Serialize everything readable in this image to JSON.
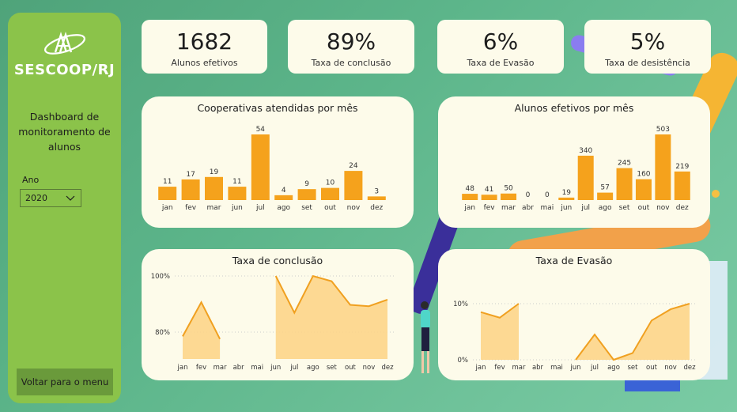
{
  "sidebar": {
    "logo_text": "SESCOOP/RJ",
    "title": "Dashboard de monitoramento de alunos",
    "filter_label": "Ano",
    "filter_value": "2020",
    "back_button": "Voltar para o menu"
  },
  "kpis": [
    {
      "value": "1682",
      "label": "Alunos efetivos"
    },
    {
      "value": "89%",
      "label": "Taxa de conclusão"
    },
    {
      "value": "6%",
      "label": "Taxa de Evasão"
    },
    {
      "value": "5%",
      "label": "Taxa de desistência"
    }
  ],
  "colors": {
    "bar": "#f5a21c",
    "area_fill": "#fdd58a",
    "area_line": "#f0a020",
    "sidebar": "#8bc34a",
    "card": "#fdfbea"
  },
  "chart_data": [
    {
      "type": "bar",
      "title": "Cooperativas atendidas por mês",
      "categories": [
        "jan",
        "fev",
        "mar",
        "jun",
        "jul",
        "ago",
        "set",
        "out",
        "nov",
        "dez"
      ],
      "values": [
        11,
        17,
        19,
        11,
        54,
        4,
        9,
        10,
        24,
        3
      ]
    },
    {
      "type": "bar",
      "title": "Alunos efetivos por mês",
      "categories": [
        "jan",
        "fev",
        "mar",
        "abr",
        "mai",
        "jun",
        "jul",
        "ago",
        "set",
        "out",
        "nov",
        "dez"
      ],
      "values": [
        48,
        41,
        50,
        0,
        0,
        19,
        340,
        57,
        245,
        160,
        503,
        219
      ]
    },
    {
      "type": "area",
      "title": "Taxa de conclusão",
      "categories": [
        "jan",
        "fev",
        "mar",
        "abr",
        "mai",
        "jun",
        "jul",
        "ago",
        "set",
        "out",
        "nov",
        "dez"
      ],
      "values": [
        77,
        90,
        76,
        null,
        null,
        100,
        86,
        100,
        98,
        89,
        88.5,
        91
      ],
      "y_ticks": [
        "80%",
        "100%"
      ],
      "ylim": [
        72,
        100
      ]
    },
    {
      "type": "area",
      "title": "Taxa de Evasão",
      "categories": [
        "jan",
        "fev",
        "mar",
        "abr",
        "mai",
        "jun",
        "jul",
        "ago",
        "set",
        "out",
        "nov",
        "dez"
      ],
      "values": [
        8.5,
        7.5,
        10,
        null,
        null,
        0,
        4.5,
        0,
        1.2,
        7,
        9,
        10
      ],
      "y_ticks": [
        "0%",
        "10%"
      ],
      "ylim": [
        0,
        10
      ]
    }
  ]
}
